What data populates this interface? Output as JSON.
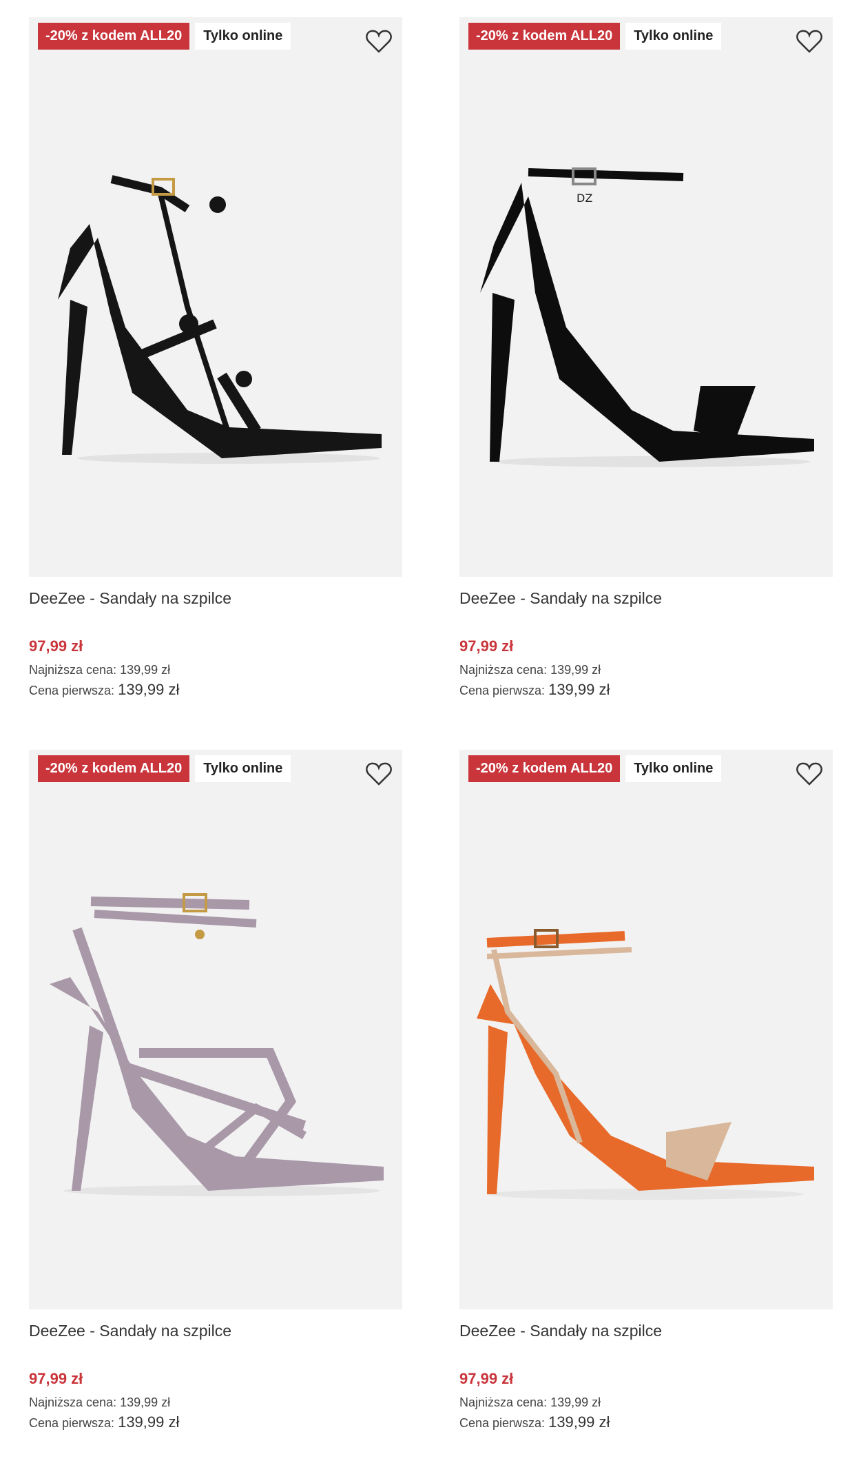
{
  "colors": {
    "promo": "#c9353b",
    "card_bg": "#f2f2f2",
    "price": "#c9353b"
  },
  "products": [
    {
      "promo_badge": "-20% z kodem ALL20",
      "online_badge": "Tylko online",
      "wishlist_icon": "heart-outline-icon",
      "shoe_color": "black satin",
      "title": "DeeZee - Sandały na szpilce",
      "price": "97,99 zł",
      "lowest_price": "Najniższa cena: 139,99 zł",
      "first_price_label": "Cena pierwsza:",
      "first_price_value": "139,99 zł"
    },
    {
      "promo_badge": "-20% z kodem ALL20",
      "online_badge": "Tylko online",
      "wishlist_icon": "heart-outline-icon",
      "shoe_color": "black patent",
      "title": "DeeZee - Sandały na szpilce",
      "price": "97,99 zł",
      "lowest_price": "Najniższa cena: 139,99 zł",
      "first_price_label": "Cena pierwsza:",
      "first_price_value": "139,99 zł"
    },
    {
      "promo_badge": "-20% z kodem ALL20",
      "online_badge": "Tylko online",
      "wishlist_icon": "heart-outline-icon",
      "shoe_color": "lilac",
      "title": "DeeZee - Sandały na szpilce",
      "price": "97,99 zł",
      "lowest_price": "Najniższa cena: 139,99 zł",
      "first_price_label": "Cena pierwsza:",
      "first_price_value": "139,99 zł"
    },
    {
      "promo_badge": "-20% z kodem ALL20",
      "online_badge": "Tylko online",
      "wishlist_icon": "heart-outline-icon",
      "shoe_color": "orange",
      "title": "DeeZee - Sandały na szpilce",
      "price": "97,99 zł",
      "lowest_price": "Najniższa cena: 139,99 zł",
      "first_price_label": "Cena pierwsza:",
      "first_price_value": "139,99 zł"
    }
  ]
}
